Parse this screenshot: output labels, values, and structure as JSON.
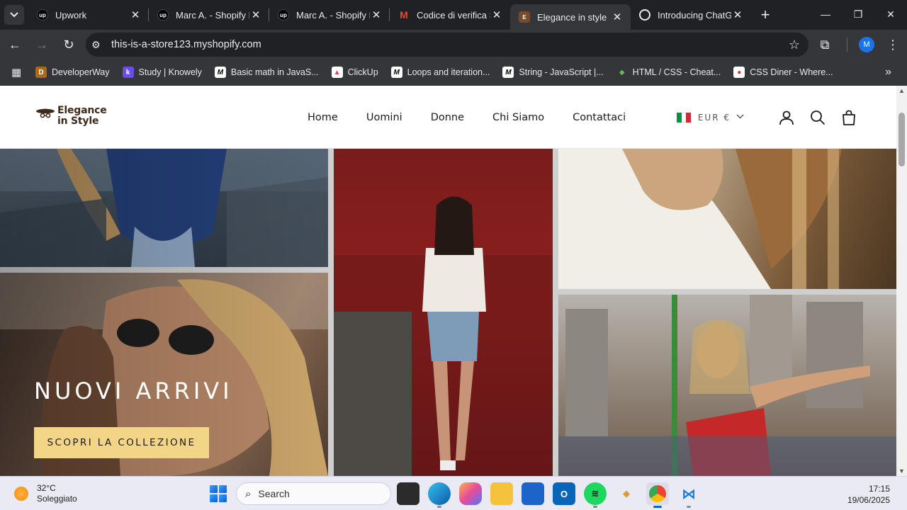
{
  "browser": {
    "tabs": [
      {
        "title": "Upwork",
        "favicon": "upwork-icon",
        "active": false
      },
      {
        "title": "Marc A. - Shopify D",
        "favicon": "upwork-icon",
        "active": false
      },
      {
        "title": "Marc A. - Shopify D",
        "favicon": "upwork-icon",
        "active": false
      },
      {
        "title": "Codice di verifica S",
        "favicon": "gmail-icon",
        "active": false
      },
      {
        "title": "Elegance in style",
        "favicon": "store-icon",
        "active": true
      },
      {
        "title": "Introducing ChatGP",
        "favicon": "chatgpt-icon",
        "active": false
      }
    ],
    "url": "this-is-a-store123.myshopify.com",
    "profile_initial": "M",
    "bookmarks": [
      {
        "label": "DeveloperWay",
        "icon": "developerway-icon"
      },
      {
        "label": "Study | Knowely",
        "icon": "knowely-icon"
      },
      {
        "label": "Basic math in JavaS...",
        "icon": "m-icon"
      },
      {
        "label": "ClickUp",
        "icon": "clickup-icon"
      },
      {
        "label": "Loops and iteration...",
        "icon": "m-icon"
      },
      {
        "label": "String - JavaScript |...",
        "icon": "m-icon"
      },
      {
        "label": "HTML / CSS - Cheat...",
        "icon": "cheatsheet-icon"
      },
      {
        "label": "CSS Diner - Where...",
        "icon": "cssdiner-icon"
      }
    ]
  },
  "site": {
    "logo_line1": "Elegance",
    "logo_line2": "in Style",
    "nav": [
      "Home",
      "Uomini",
      "Donne",
      "Chi Siamo",
      "Contattaci"
    ],
    "currency": "EUR €",
    "hero": {
      "title": "NUOVI ARRIVI",
      "cta": "SCOPRI LA COLLEZIONE"
    },
    "colors": {
      "cta": "#f3d587",
      "brand": "#3d2a1a"
    }
  },
  "taskbar": {
    "temperature": "32°C",
    "weather": "Soleggiato",
    "search_placeholder": "Search",
    "time": "17:15",
    "date": "19/06/2025"
  }
}
